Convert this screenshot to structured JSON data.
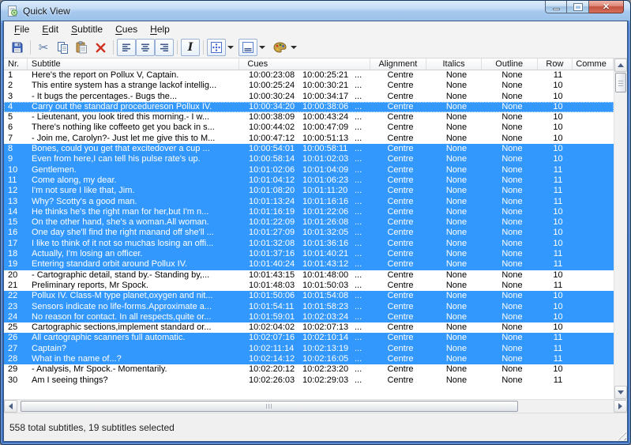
{
  "window": {
    "title": "Quick View"
  },
  "menu": {
    "items": [
      "File",
      "Edit",
      "Subtitle",
      "Cues",
      "Help"
    ]
  },
  "toolbar": {
    "buttons": [
      "save",
      "cut",
      "copy",
      "paste",
      "delete",
      "align-left",
      "align-centre",
      "align-right",
      "italic",
      "position-grid",
      "outline-style",
      "colour-palette"
    ]
  },
  "table": {
    "columns": [
      {
        "key": "nr",
        "label": "Nr."
      },
      {
        "key": "subtitle",
        "label": "Subtitle"
      },
      {
        "key": "cues",
        "label": "Cues"
      },
      {
        "key": "alignment",
        "label": "Alignment"
      },
      {
        "key": "italics",
        "label": "Italics"
      },
      {
        "key": "outline",
        "label": "Outline"
      },
      {
        "key": "row",
        "label": "Row"
      },
      {
        "key": "comment",
        "label": "Comme"
      }
    ],
    "cues_ellipsis": "...",
    "rows": [
      {
        "nr": "1",
        "subtitle": "Here's the report on Pollux V, Captain.",
        "cue_in": "10:00:23:08",
        "cue_out": "10:00:25:21",
        "alignment": "Centre",
        "italics": "None",
        "outline": "None",
        "row": "11",
        "selected": false,
        "focused": false
      },
      {
        "nr": "2",
        "subtitle": "This entire system has a strange lackof intellig...",
        "cue_in": "10:00:25:24",
        "cue_out": "10:00:30:21",
        "alignment": "Centre",
        "italics": "None",
        "outline": "None",
        "row": "10",
        "selected": false,
        "focused": false
      },
      {
        "nr": "3",
        "subtitle": "- It bugs the percentages.- Bugs the...",
        "cue_in": "10:00:30:24",
        "cue_out": "10:00:34:17",
        "alignment": "Centre",
        "italics": "None",
        "outline": "None",
        "row": "10",
        "selected": false,
        "focused": false
      },
      {
        "nr": "4",
        "subtitle": "Carry out the standard procedureson Pollux IV.",
        "cue_in": "10:00:34:20",
        "cue_out": "10:00:38:06",
        "alignment": "Centre",
        "italics": "None",
        "outline": "None",
        "row": "10",
        "selected": true,
        "focused": true
      },
      {
        "nr": "5",
        "subtitle": "- Lieutenant, you look tired this morning.- I w...",
        "cue_in": "10:00:38:09",
        "cue_out": "10:00:43:24",
        "alignment": "Centre",
        "italics": "None",
        "outline": "None",
        "row": "10",
        "selected": false,
        "focused": false
      },
      {
        "nr": "6",
        "subtitle": "There's nothing like coffeeto get you back in s...",
        "cue_in": "10:00:44:02",
        "cue_out": "10:00:47:09",
        "alignment": "Centre",
        "italics": "None",
        "outline": "None",
        "row": "10",
        "selected": false,
        "focused": false
      },
      {
        "nr": "7",
        "subtitle": "- Join me, Carolyn?- Just let me give this to M...",
        "cue_in": "10:00:47:12",
        "cue_out": "10:00:51:13",
        "alignment": "Centre",
        "italics": "None",
        "outline": "None",
        "row": "10",
        "selected": false,
        "focused": false
      },
      {
        "nr": "8",
        "subtitle": "Bones, could you get that excitedover a cup ...",
        "cue_in": "10:00:54:01",
        "cue_out": "10:00:58:11",
        "alignment": "Centre",
        "italics": "None",
        "outline": "None",
        "row": "10",
        "selected": true,
        "focused": false
      },
      {
        "nr": "9",
        "subtitle": "Even from here,I can tell his pulse rate's up.",
        "cue_in": "10:00:58:14",
        "cue_out": "10:01:02:03",
        "alignment": "Centre",
        "italics": "None",
        "outline": "None",
        "row": "10",
        "selected": true,
        "focused": false
      },
      {
        "nr": "10",
        "subtitle": "Gentlemen.",
        "cue_in": "10:01:02:06",
        "cue_out": "10:01:04:09",
        "alignment": "Centre",
        "italics": "None",
        "outline": "None",
        "row": "11",
        "selected": true,
        "focused": false
      },
      {
        "nr": "11",
        "subtitle": "Come along, my dear.",
        "cue_in": "10:01:04:12",
        "cue_out": "10:01:06:23",
        "alignment": "Centre",
        "italics": "None",
        "outline": "None",
        "row": "11",
        "selected": true,
        "focused": false
      },
      {
        "nr": "12",
        "subtitle": "I'm not sure I like that, Jim.",
        "cue_in": "10:01:08:20",
        "cue_out": "10:01:11:20",
        "alignment": "Centre",
        "italics": "None",
        "outline": "None",
        "row": "11",
        "selected": true,
        "focused": false
      },
      {
        "nr": "13",
        "subtitle": "Why? Scotty's a good man.",
        "cue_in": "10:01:13:24",
        "cue_out": "10:01:16:16",
        "alignment": "Centre",
        "italics": "None",
        "outline": "None",
        "row": "11",
        "selected": true,
        "focused": false
      },
      {
        "nr": "14",
        "subtitle": "He thinks he's the right man for her,but I'm n...",
        "cue_in": "10:01:16:19",
        "cue_out": "10:01:22:06",
        "alignment": "Centre",
        "italics": "None",
        "outline": "None",
        "row": "10",
        "selected": true,
        "focused": false
      },
      {
        "nr": "15",
        "subtitle": "On the other hand, she's a woman.All woman.",
        "cue_in": "10:01:22:09",
        "cue_out": "10:01:26:08",
        "alignment": "Centre",
        "italics": "None",
        "outline": "None",
        "row": "10",
        "selected": true,
        "focused": false
      },
      {
        "nr": "16",
        "subtitle": "One day she'll find the right manand off she'll ...",
        "cue_in": "10:01:27:09",
        "cue_out": "10:01:32:05",
        "alignment": "Centre",
        "italics": "None",
        "outline": "None",
        "row": "10",
        "selected": true,
        "focused": false
      },
      {
        "nr": "17",
        "subtitle": "I like to think of it not so muchas losing an offi...",
        "cue_in": "10:01:32:08",
        "cue_out": "10:01:36:16",
        "alignment": "Centre",
        "italics": "None",
        "outline": "None",
        "row": "10",
        "selected": true,
        "focused": false
      },
      {
        "nr": "18",
        "subtitle": "Actually, I'm losing an officer.",
        "cue_in": "10:01:37:16",
        "cue_out": "10:01:40:21",
        "alignment": "Centre",
        "italics": "None",
        "outline": "None",
        "row": "11",
        "selected": true,
        "focused": false
      },
      {
        "nr": "19",
        "subtitle": "Entering standard orbit around Pollux IV.",
        "cue_in": "10:01:40:24",
        "cue_out": "10:01:43:12",
        "alignment": "Centre",
        "italics": "None",
        "outline": "None",
        "row": "11",
        "selected": true,
        "focused": false
      },
      {
        "nr": "20",
        "subtitle": "- Cartographic detail, stand by.- Standing by,...",
        "cue_in": "10:01:43:15",
        "cue_out": "10:01:48:00",
        "alignment": "Centre",
        "italics": "None",
        "outline": "None",
        "row": "10",
        "selected": false,
        "focused": false
      },
      {
        "nr": "21",
        "subtitle": "Preliminary reports, Mr Spock.",
        "cue_in": "10:01:48:03",
        "cue_out": "10:01:50:03",
        "alignment": "Centre",
        "italics": "None",
        "outline": "None",
        "row": "11",
        "selected": false,
        "focused": false
      },
      {
        "nr": "22",
        "subtitle": "Pollux IV. Class-M type planet,oxygen and nit...",
        "cue_in": "10:01:50:06",
        "cue_out": "10:01:54:08",
        "alignment": "Centre",
        "italics": "None",
        "outline": "None",
        "row": "10",
        "selected": true,
        "focused": false
      },
      {
        "nr": "23",
        "subtitle": "Sensors indicate no life-forms.Approximate a...",
        "cue_in": "10:01:54:11",
        "cue_out": "10:01:58:23",
        "alignment": "Centre",
        "italics": "None",
        "outline": "None",
        "row": "10",
        "selected": true,
        "focused": false
      },
      {
        "nr": "24",
        "subtitle": "No reason for contact. In all respects,quite or...",
        "cue_in": "10:01:59:01",
        "cue_out": "10:02:03:24",
        "alignment": "Centre",
        "italics": "None",
        "outline": "None",
        "row": "10",
        "selected": true,
        "focused": false
      },
      {
        "nr": "25",
        "subtitle": "Cartographic sections,implement standard or...",
        "cue_in": "10:02:04:02",
        "cue_out": "10:02:07:13",
        "alignment": "Centre",
        "italics": "None",
        "outline": "None",
        "row": "10",
        "selected": false,
        "focused": false
      },
      {
        "nr": "26",
        "subtitle": "All cartographic scanners full automatic.",
        "cue_in": "10:02:07:16",
        "cue_out": "10:02:10:14",
        "alignment": "Centre",
        "italics": "None",
        "outline": "None",
        "row": "11",
        "selected": true,
        "focused": false
      },
      {
        "nr": "27",
        "subtitle": "Captain?",
        "cue_in": "10:02:11:14",
        "cue_out": "10:02:13:19",
        "alignment": "Centre",
        "italics": "None",
        "outline": "None",
        "row": "11",
        "selected": true,
        "focused": false
      },
      {
        "nr": "28",
        "subtitle": "What in the name of...?",
        "cue_in": "10:02:14:12",
        "cue_out": "10:02:16:05",
        "alignment": "Centre",
        "italics": "None",
        "outline": "None",
        "row": "11",
        "selected": true,
        "focused": false
      },
      {
        "nr": "29",
        "subtitle": "- Analysis, Mr Spock.- Momentarily.",
        "cue_in": "10:02:20:12",
        "cue_out": "10:02:23:20",
        "alignment": "Centre",
        "italics": "None",
        "outline": "None",
        "row": "10",
        "selected": false,
        "focused": false
      },
      {
        "nr": "30",
        "subtitle": "Am I seeing things?",
        "cue_in": "10:02:26:03",
        "cue_out": "10:02:29:03",
        "alignment": "Centre",
        "italics": "None",
        "outline": "None",
        "row": "11",
        "selected": false,
        "focused": false
      }
    ]
  },
  "status": {
    "text": "558 total subtitles, 19 subtitles selected"
  },
  "colors": {
    "selection": "#3398FE",
    "selection_text": "#FFFFFF",
    "frame": "#4A7CC8",
    "close_button": "#C25140"
  }
}
